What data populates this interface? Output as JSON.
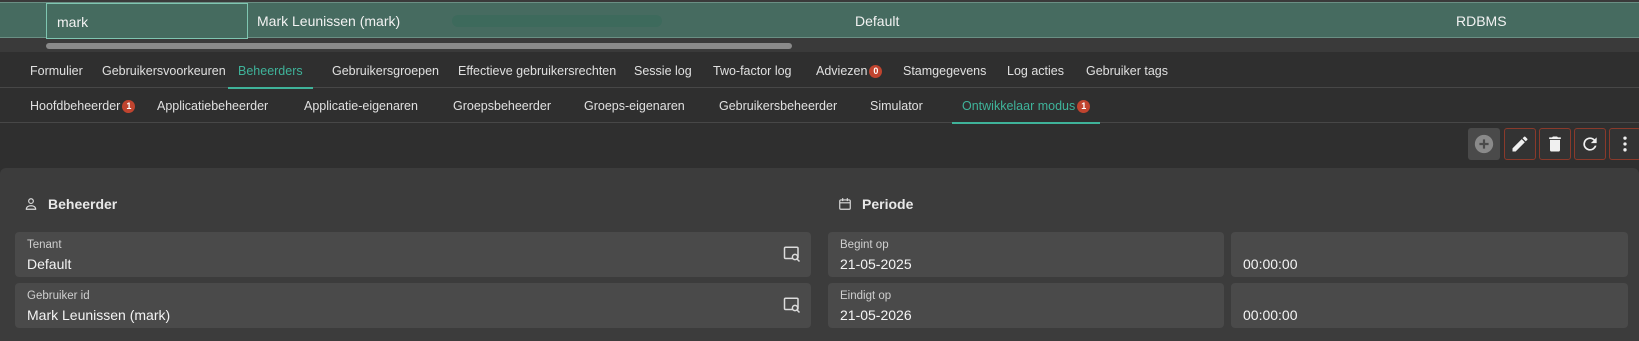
{
  "grid": {
    "username": "mark",
    "fullname": "Mark Leunissen (mark)",
    "tenant": "Default",
    "auth": "RDBMS"
  },
  "tabs_main": [
    {
      "label": "Formulier"
    },
    {
      "label": "Gebruikersvoorkeuren"
    },
    {
      "label": "Beheerders"
    },
    {
      "label": "Gebruikersgroepen"
    },
    {
      "label": "Effectieve gebruikersrechten"
    },
    {
      "label": "Sessie log"
    },
    {
      "label": "Two-factor log"
    },
    {
      "label": "Adviezen",
      "badge": "0"
    },
    {
      "label": "Stamgegevens"
    },
    {
      "label": "Log acties"
    },
    {
      "label": "Gebruiker tags"
    }
  ],
  "tabs_sub": [
    {
      "label": "Hoofdbeheerder",
      "badge": "1"
    },
    {
      "label": "Applicatiebeheerder"
    },
    {
      "label": "Applicatie-eigenaren"
    },
    {
      "label": "Groepsbeheerder"
    },
    {
      "label": "Groeps-eigenaren"
    },
    {
      "label": "Gebruikersbeheerder"
    },
    {
      "label": "Simulator"
    },
    {
      "label": "Ontwikkelaar modus",
      "badge": "1"
    }
  ],
  "form": {
    "section_beheerder": "Beheerder",
    "section_periode": "Periode",
    "tenant_label": "Tenant",
    "tenant_value": "Default",
    "user_label": "Gebruiker id",
    "user_value": "Mark Leunissen (mark)",
    "start_label": "Begint op",
    "start_date": "21-05-2025",
    "start_time": "00:00:00",
    "end_label": "Eindigt op",
    "end_date": "21-05-2026",
    "end_time": "00:00:00"
  },
  "icons": {
    "add": "plus-circle-icon",
    "edit": "pencil-icon",
    "delete": "trash-icon",
    "refresh": "refresh-icon",
    "more": "more-vertical-icon",
    "lookup": "search-window-icon",
    "person": "person-icon",
    "calendar": "calendar-icon"
  },
  "colors": {
    "accent": "#3fb39a",
    "badge": "#c0442f",
    "selected_row": "#466b60",
    "danger_border": "#8a3a2b"
  }
}
